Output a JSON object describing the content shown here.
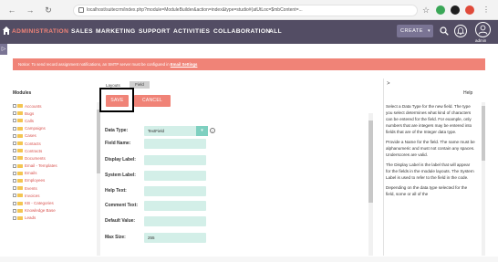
{
  "browser": {
    "url": "localhost/suitecrm/index.php?module=ModuleBuilder&action=index&type=studio#(atUtLoc=$mbContent=...",
    "back_glyph": "←",
    "forward_glyph": "→",
    "reload_glyph": "↻",
    "star_glyph": "☆"
  },
  "nav": {
    "admin": "ADMINISTRATION",
    "items": [
      "SALES",
      "MARKETING",
      "SUPPORT",
      "ACTIVITIES",
      "COLLABORATION",
      "ALL"
    ],
    "create_label": "CREATE",
    "create_caret": "▾",
    "user_name": "admin",
    "side_handle": "▷"
  },
  "alert": {
    "text": "Notice: To send record assignment notifications, an SMTP server must be configured in ",
    "link": "Email Settings"
  },
  "modules": {
    "title": "Modules",
    "items": [
      "Accounts",
      "Bugs",
      "Calls",
      "Campaigns",
      "Cases",
      "Contacts",
      "Contracts",
      "Documents",
      "Email - Templates",
      "Emails",
      "Employees",
      "Events",
      "Invoices",
      "KB - Categories",
      "Knowledge Base",
      "Leads"
    ]
  },
  "editor": {
    "tab_layout": "Layouts",
    "tab_field": "Field",
    "save_label": "SAVE",
    "cancel_label": "CANCEL",
    "select_arrow": "▾",
    "info_glyph": "i",
    "fields": [
      {
        "label": "Data Type:",
        "value": "TextField"
      },
      {
        "label": "Field Name:",
        "value": ""
      },
      {
        "label": "Display Label:",
        "value": ""
      },
      {
        "label": "System Label:",
        "value": ""
      },
      {
        "label": "Help Text:",
        "value": ""
      },
      {
        "label": "Comment Text:",
        "value": ""
      },
      {
        "label": "Default Value:",
        "value": ""
      },
      {
        "label": "Max Size:",
        "value": "255"
      }
    ]
  },
  "help": {
    "arrow": ">",
    "title": "Help",
    "paragraphs": [
      "Select a Data Type for the new field. The type you select determines what kind of characters can be entered for the field. For example, only numbers that are integers may be entered into fields that are of the Integer data type.",
      "Provide a Name for the field. The name must be alphanumeric and must not contain any spaces. Underscores are valid.",
      "The Display Label is the label that will appear for the fields in the module layouts. The System Label is used to refer to the field in the code.",
      "Depending on the data type selected for the field, some or all of the"
    ]
  },
  "colors": {
    "nav_bg": "#534d64",
    "accent": "#f08377",
    "input_bg": "#d3efe8"
  }
}
